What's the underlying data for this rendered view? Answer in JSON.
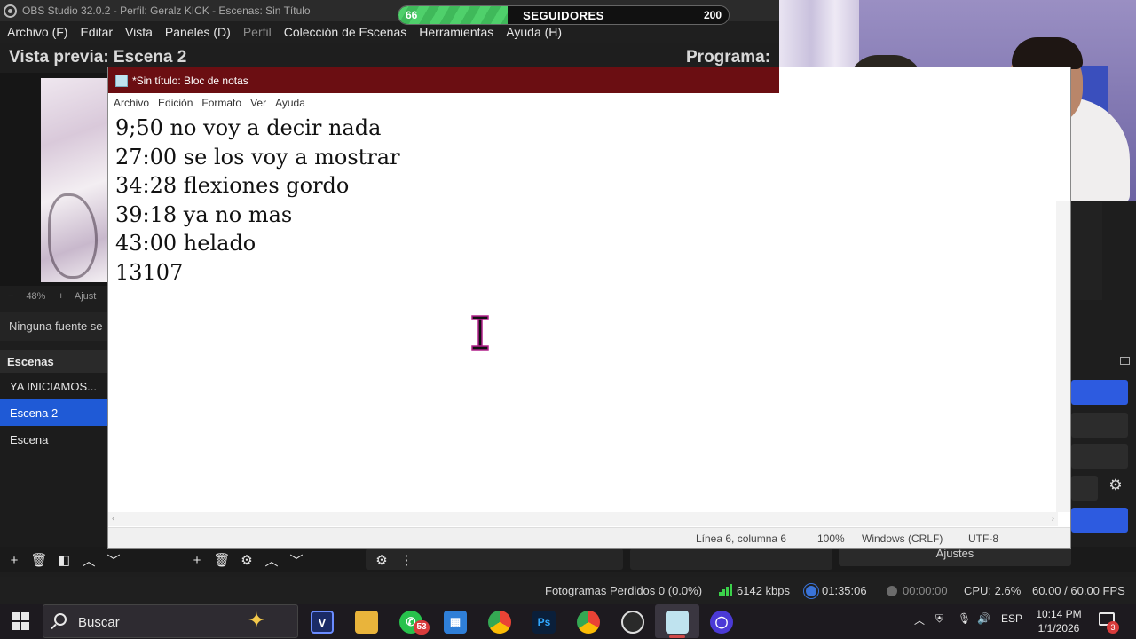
{
  "obs": {
    "window_title": "OBS Studio 32.0.2 - Perfil: Geralz KICK - Escenas: Sin Título",
    "menu": [
      "Archivo (F)",
      "Editar",
      "Vista",
      "Paneles (D)",
      "Perfil",
      "Colección de Escenas",
      "Herramientas",
      "Ayuda (H)"
    ],
    "preview_title": "Vista previa: Escena 2",
    "program_title": "Programa:",
    "zoom_minus": "−",
    "zoom_level": "48%",
    "zoom_plus": "+",
    "zoom_fit": "Ajust",
    "no_source": "Ninguna fuente se",
    "scenes_header": "Escenas",
    "scenes": [
      "YA INICIAMOS...",
      "Escena 2",
      "Escena"
    ],
    "active_scene_index": 1,
    "settings_button": "Ajustes",
    "status": {
      "dropped_frames": "Fotogramas Perdidos 0 (0.0%)",
      "bitrate": "6142 kbps",
      "live_time": "01:35:06",
      "rec_time": "00:00:00",
      "cpu": "CPU: 2.6%",
      "fps": "60.00 / 60.00 FPS"
    },
    "accent_color": "#1f5ad6"
  },
  "followers": {
    "current": "66",
    "label": "SEGUIDORES",
    "goal": "200",
    "progress": 0.33
  },
  "notepad": {
    "title": "*Sin título: Bloc de notas",
    "menu": [
      "Archivo",
      "Edición",
      "Formato",
      "Ver",
      "Ayuda"
    ],
    "lines": [
      "9;50 no voy a decir nada",
      "27:00 se los voy a mostrar",
      "34:28 flexiones gordo",
      "39:18 ya no mas",
      "43:00 helado",
      "13107"
    ],
    "status": {
      "position": "Línea 6, columna 6",
      "zoom": "100%",
      "line_endings": "Windows (CRLF)",
      "encoding": "UTF-8"
    },
    "titlebar_color": "#6b0e12"
  },
  "taskbar": {
    "search_placeholder": "Buscar",
    "whatsapp_badge": "53",
    "language": "ESP",
    "time": "10:14 PM",
    "date": "1/1/2026",
    "notification_badge": "3",
    "apps": [
      "vegas-icon",
      "file-explorer-icon",
      "whatsapp-icon",
      "store-icon",
      "photoshop-icon",
      "chrome-icon",
      "chrome-profile-icon",
      "obs-icon",
      "notepad-icon",
      "cortana-icon"
    ]
  }
}
